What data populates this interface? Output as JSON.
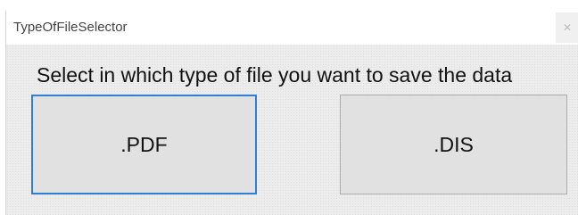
{
  "window": {
    "title": "TypeOfFileSelector",
    "close_glyph": "✕"
  },
  "main": {
    "prompt": "Select in which type of file you want to save the data",
    "buttons": [
      {
        "label": ".PDF",
        "focused": true
      },
      {
        "label": ".DIS",
        "focused": false
      }
    ]
  },
  "colors": {
    "focus_border": "#2f7ed8",
    "button_face": "#e1e1e1",
    "window_background": "#f0f0f0"
  }
}
